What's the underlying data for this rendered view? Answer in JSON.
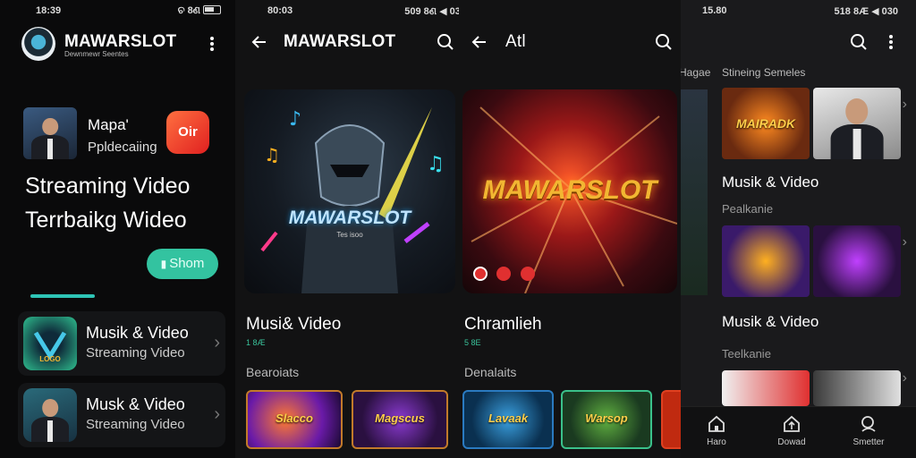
{
  "screen1": {
    "status_time": "18:39",
    "status_right": "ଚ 8ଣ",
    "title": "MAWARSLOT",
    "subtitle": "Dewnmewr Seentes",
    "featured": {
      "name": "Mapa'",
      "sub": "Ppldecaiing",
      "red_app_text": "Oir"
    },
    "hero_line1": "Streaming Video",
    "hero_line2": "Terrbaikg Wideo",
    "show_button": "Shom",
    "list": [
      {
        "title": "Musik & Video",
        "sub": "Streaming Video"
      },
      {
        "title": "Musk & Video",
        "sub": "Streaming Video"
      }
    ]
  },
  "screen2": {
    "status_time": "80:03",
    "status_right": "509 8ଣ ◀ 030",
    "title": "MAWARSLOT",
    "card_logo": "MAWARSLOT",
    "card_sub": "Tes isoo",
    "section_title": "Musi& Video",
    "section_sub": "1 8Æ",
    "section_label": "Bearoiats",
    "small_cards": [
      "Slacco",
      "Magscus"
    ]
  },
  "screen3": {
    "title": "Atl",
    "card_logo": "MAWARSLOT",
    "section_title": "Chramlieh",
    "section_sub": "5 8E",
    "section_label": "Denalaits",
    "small_cards": [
      "Lavaak",
      "Warsop"
    ]
  },
  "screen4": {
    "status_time": "15.80",
    "status_right": "518 8Æ ◀ 030",
    "tab_left": "Hagae",
    "tab_right": "Stineing Semeles",
    "thumb1_text": "MAIRADK",
    "section1_title": "Musik & Video",
    "section1_sub": "Pealkanie",
    "section2_title": "Musik & Video",
    "section2_sub": "Teelkanie",
    "nav": [
      {
        "icon": "home-icon",
        "label": "Haro"
      },
      {
        "icon": "upload-icon",
        "label": "Dowad"
      },
      {
        "icon": "search-icon",
        "label": "Smetter"
      }
    ]
  },
  "colors": {
    "accent_teal": "#2ec4b6",
    "show_button": "#33c3a0",
    "logo_gold": "#f2b632",
    "red_app": "#e02020"
  }
}
